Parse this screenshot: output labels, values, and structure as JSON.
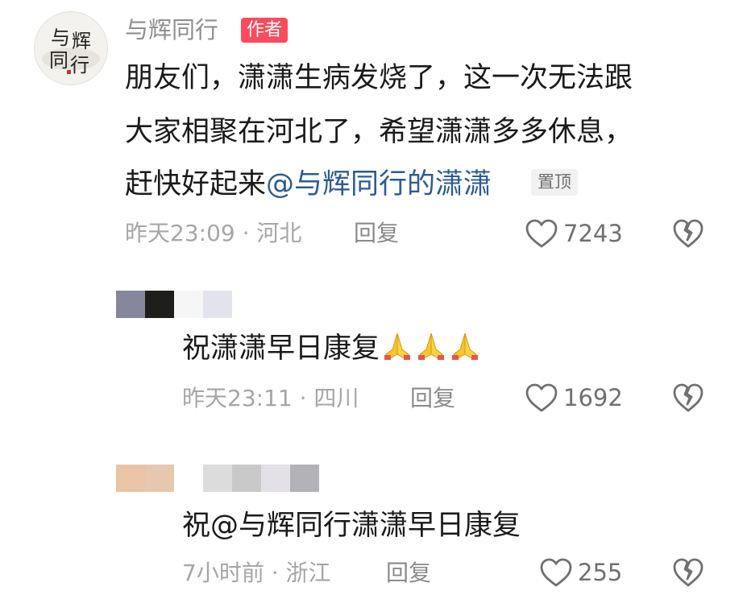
{
  "comment": {
    "author": "与辉同行",
    "author_badge": "作者",
    "avatar_text_1": "与",
    "avatar_text_2": "辉",
    "avatar_text_3": "同",
    "avatar_text_4": "行",
    "lines": [
      "朋友们，潇潇生病发烧了，这一次无法跟",
      "大家相聚在河北了，希望潇潇多多休息，",
      "赶快好起来"
    ],
    "mention": "@与辉同行的潇潇",
    "pin_badge": "置顶",
    "time_location": "昨天23:09 · 河北",
    "reply_label": "回复",
    "likes": "7243"
  },
  "replies": [
    {
      "text": "祝潇潇早日康复",
      "emoji": "folded-hands-icon x3",
      "time_location": "昨天23:11 · 四川",
      "reply_label": "回复",
      "likes": "1692"
    },
    {
      "text": "祝@与辉同行潇潇早日康复",
      "time_location": "7小时前 · 浙江",
      "reply_label": "回复",
      "likes": "255"
    }
  ],
  "colors": {
    "badge_red": "#fa4c5c",
    "mention_blue": "#2f5b8f",
    "meta_gray": "#a6a6a6"
  }
}
